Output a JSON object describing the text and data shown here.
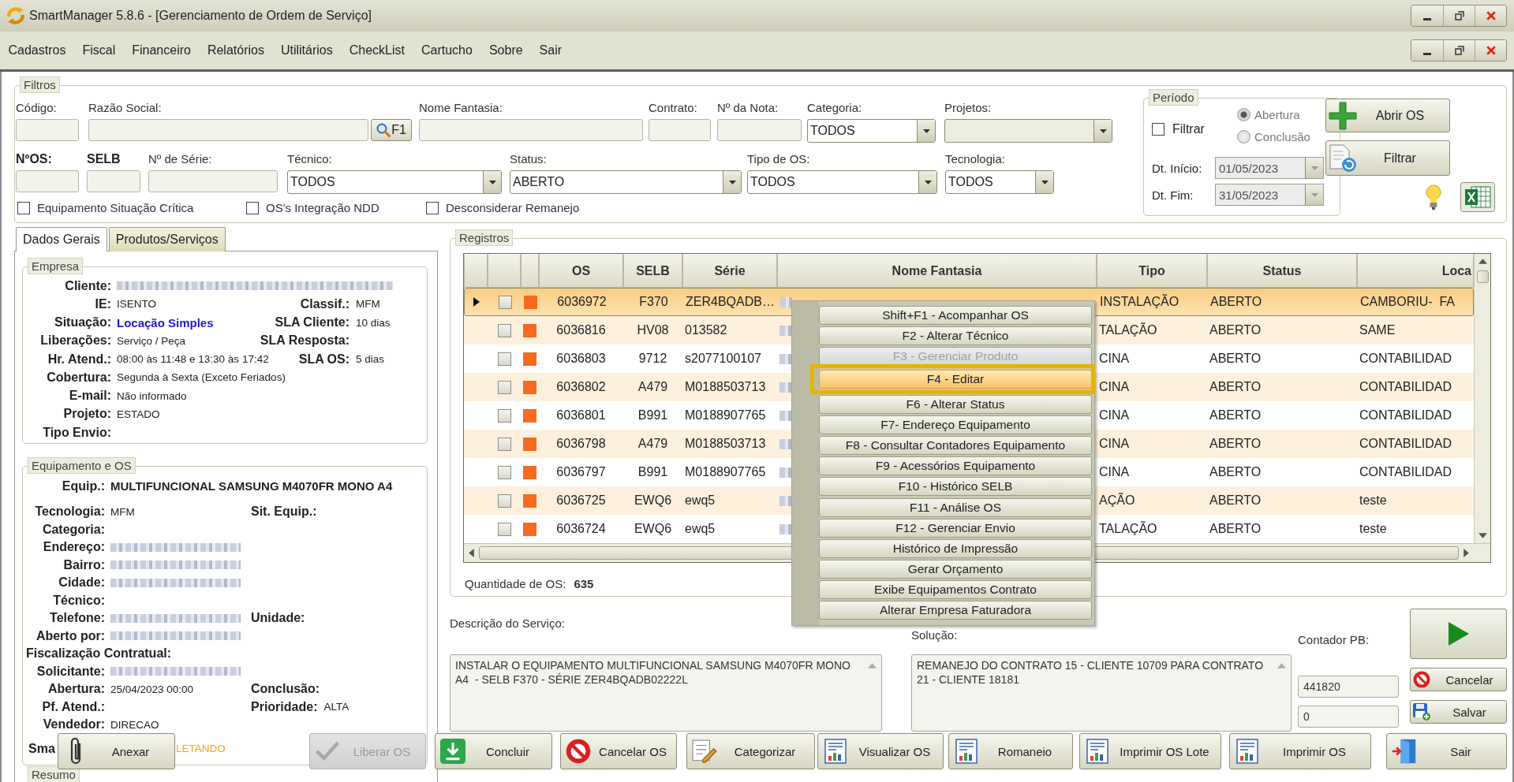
{
  "window": {
    "title": "SmartManager 5.8.6 - [Gerenciamento de Ordem de Serviço]"
  },
  "menu": [
    "Cadastros",
    "Fiscal",
    "Financeiro",
    "Relatórios",
    "Utilitários",
    "CheckList",
    "Cartucho",
    "Sobre",
    "Sair"
  ],
  "filters": {
    "title": "Filtros",
    "row1": [
      {
        "label": "Código:",
        "kind": "text",
        "bold": false
      },
      {
        "label": "Razão Social:",
        "kind": "search",
        "button": "F1",
        "bold": false
      },
      {
        "label": "Nome Fantasia:",
        "kind": "text",
        "bold": false
      },
      {
        "label": "Contrato:",
        "kind": "text",
        "bold": false
      },
      {
        "label": "Nº da Nota:",
        "kind": "text",
        "bold": false
      },
      {
        "label": "Categoria:",
        "kind": "select",
        "value": "TODOS",
        "bold": false
      },
      {
        "label": "Projetos:",
        "kind": "select",
        "bold": false
      }
    ],
    "row2": [
      {
        "label": "NºOS:",
        "kind": "text",
        "bold": true
      },
      {
        "label": "SELB",
        "kind": "text",
        "bold": true
      },
      {
        "label": "Nº de Série:",
        "kind": "text",
        "bold": false
      },
      {
        "label": "Técnico:",
        "kind": "select",
        "value": "TODOS",
        "bold": false
      },
      {
        "label": "Status:",
        "kind": "select",
        "value": "ABERTO",
        "bold": false
      },
      {
        "label": "Tipo de OS:",
        "kind": "select",
        "value": "TODOS",
        "bold": false
      },
      {
        "label": "Tecnologia:",
        "kind": "select",
        "value": "TODOS",
        "bold": false
      }
    ],
    "checks": [
      {
        "label": "Equipamento Situação Crítica",
        "checked": false
      },
      {
        "label": "OS's Integração NDD",
        "checked": false
      },
      {
        "label": "Desconsiderar Remanejo",
        "checked": false
      }
    ]
  },
  "periodo": {
    "title": "Período",
    "filter": {
      "label": "Filtrar",
      "checked": false
    },
    "options": [
      {
        "label": "Abertura",
        "selected": true,
        "disabled": true
      },
      {
        "label": "Conclusão",
        "selected": false,
        "disabled": true
      }
    ],
    "dates": [
      {
        "label": "Dt. Início:",
        "value": "01/05/2023",
        "disabled": true
      },
      {
        "label": "Dt. Fim:",
        "value": "31/05/2023",
        "disabled": true
      }
    ]
  },
  "actions": [
    {
      "label": "Abrir OS",
      "kind": "add"
    },
    {
      "label": "Filtrar",
      "kind": "filter"
    }
  ],
  "tools": [
    {
      "kind": "tip"
    },
    {
      "kind": "excel"
    }
  ],
  "tabs": [
    {
      "label": "Dados Gerais",
      "selected": true
    },
    {
      "label": "Produtos/Serviços",
      "selected": false
    }
  ],
  "empresa": {
    "title": "Empresa",
    "rows": [
      [
        {
          "label": "Cliente:",
          "redacted": true
        }
      ],
      [
        {
          "label": "IE:",
          "value": "ISENTO"
        },
        {
          "label": "Classif.:",
          "value": "MFM"
        }
      ],
      [
        {
          "label": "Situação:",
          "value": "Locação Simples",
          "color": "#1c1cd0",
          "bold": true
        },
        {
          "label": "SLA Cliente:",
          "value": "10 dias"
        }
      ],
      [
        {
          "label": "Liberações:",
          "value": "Serviço / Peça"
        },
        {
          "label": "SLA Resposta:"
        }
      ],
      [
        {
          "label": "Hr. Atend.:",
          "value": "08:00 às 11:48 e 13:30 às 17:42"
        },
        {
          "label": "SLA OS:",
          "value": "5 dias"
        }
      ],
      [
        {
          "label": "Cobertura:",
          "value": "Segunda à Sexta (Exceto Feriados)"
        }
      ],
      [
        {
          "label": "E-mail:",
          "value": "Não informado"
        }
      ],
      [
        {
          "label": "Projeto:",
          "value": "ESTADO"
        }
      ],
      [
        {
          "label": "Tipo Envio:"
        }
      ]
    ]
  },
  "equipamento": {
    "title": "Equipamento e OS",
    "rows": [
      [
        {
          "label": "Equip.:",
          "value": "MULTIFUNCIONAL SAMSUNG M4070FR MONO A4",
          "bold": true
        }
      ],
      [
        {
          "label": "Tecnologia:",
          "value": "MFM"
        },
        {
          "label": "Sit. Equip.:"
        }
      ],
      [
        {
          "label": "Categoria:"
        }
      ],
      [
        {
          "label": "Endereço:",
          "redacted": true
        }
      ],
      [
        {
          "label": "Bairro:",
          "redacted": true
        }
      ],
      [
        {
          "label": "Cidade:",
          "redacted": true
        }
      ],
      [
        {
          "label": "Técnico:"
        }
      ],
      [
        {
          "label": "Telefone:",
          "redacted": true
        },
        {
          "label": "Unidade:"
        }
      ],
      [
        {
          "label": "Aberto por:",
          "redacted": true
        }
      ],
      [
        {
          "label": "Fiscalização Contratual:"
        }
      ],
      [
        {
          "label": "Solicitante:",
          "redacted": true
        }
      ],
      [
        {
          "label": "Abertura:",
          "value": "25/04/2023 00:00"
        },
        {
          "label": "Conclusão:"
        }
      ],
      [
        {
          "label": "Pf. Atend.:"
        },
        {
          "label": "Prioridade:",
          "value": "ALTA"
        }
      ],
      [
        {
          "label": "Vendedor:",
          "value": "DIRECAO"
        }
      ]
    ],
    "partial_row": {
      "label": "Sma",
      "value": "LETANDO",
      "color": "#f7a21b"
    }
  },
  "resumo": {
    "title": "Resumo"
  },
  "registros": {
    "title": "Registros",
    "columns": [
      "OS",
      "SELB",
      "Série",
      "Nome Fantasia",
      "Tipo",
      "Status",
      "Loca"
    ],
    "rows": [
      {
        "selected": true,
        "checked": false,
        "color": "#f86a1e",
        "os": "6036972",
        "selb": "F370",
        "serie": "ZER4BQADB…",
        "nome_fantasia": {
          "redacted": true
        },
        "tipo": "INSTALAÇÃO",
        "status": "ABERTO",
        "column_7": "CAMBORIU-  FA"
      },
      {
        "selected": false,
        "checked": false,
        "color": "#f86a1e",
        "os": "6036816",
        "selb": "HV08",
        "serie": "013582",
        "nome_fantasia": {
          "redacted": true
        },
        "tipo": "TALAÇÃO",
        "status": "ABERTO",
        "column_7": "SAME"
      },
      {
        "selected": false,
        "checked": false,
        "color": "#f86a1e",
        "os": "6036803",
        "selb": "9712",
        "serie": "s2077100107",
        "nome_fantasia": {
          "redacted": true
        },
        "tipo": "CINA",
        "status": "ABERTO",
        "column_7": "CONTABILIDAD"
      },
      {
        "selected": false,
        "checked": false,
        "color": "#f86a1e",
        "os": "6036802",
        "selb": "A479",
        "serie": "M0188503713",
        "nome_fantasia": {
          "redacted": true
        },
        "tipo": "CINA",
        "status": "ABERTO",
        "column_7": "CONTABILIDAD"
      },
      {
        "selected": false,
        "checked": false,
        "color": "#f86a1e",
        "os": "6036801",
        "selb": "B991",
        "serie": "M0188907765",
        "nome_fantasia": {
          "redacted": true
        },
        "tipo": "CINA",
        "status": "ABERTO",
        "column_7": "CONTABILIDAD"
      },
      {
        "selected": false,
        "checked": false,
        "color": "#f86a1e",
        "os": "6036798",
        "selb": "A479",
        "serie": "M0188503713",
        "nome_fantasia": {
          "redacted": true
        },
        "tipo": "CINA",
        "status": "ABERTO",
        "column_7": "CONTABILIDAD"
      },
      {
        "selected": false,
        "checked": false,
        "color": "#f86a1e",
        "os": "6036797",
        "selb": "B991",
        "serie": "M0188907765",
        "nome_fantasia": {
          "redacted": true
        },
        "tipo": "CINA",
        "status": "ABERTO",
        "column_7": "CONTABILIDAD"
      },
      {
        "selected": false,
        "checked": false,
        "color": "#f86a1e",
        "os": "6036725",
        "selb": "EWQ6",
        "serie": "ewq5",
        "nome_fantasia": {
          "redacted": true
        },
        "tipo": "AÇÃO",
        "status": "ABERTO",
        "column_7": "teste"
      },
      {
        "selected": false,
        "checked": false,
        "color": "#f86a1e",
        "os": "6036724",
        "selb": "EWQ6",
        "serie": "ewq5",
        "nome_fantasia": {
          "redacted": true
        },
        "tipo": "TALAÇÃO",
        "status": "ABERTO",
        "column_7": "teste"
      }
    ],
    "count_label": "Quantidade de OS:",
    "count": "635"
  },
  "context_menu": {
    "items": [
      {
        "label": "Shift+F1 - Acompanhar OS",
        "disabled": false,
        "selected": false,
        "highlighted": false
      },
      {
        "label": "F2 - Alterar Técnico",
        "disabled": false,
        "selected": false,
        "highlighted": false
      },
      {
        "label": "F3 - Gerenciar Produto",
        "disabled": true,
        "selected": false,
        "highlighted": false
      },
      {
        "label": "F4 - Editar",
        "disabled": false,
        "selected": true,
        "highlighted": true
      },
      {
        "label": "F6 - Alterar Status",
        "disabled": false,
        "selected": false,
        "highlighted": false
      },
      {
        "label": "F7- Endereço Equipamento",
        "disabled": false,
        "selected": false,
        "highlighted": false
      },
      {
        "label": "F8 - Consultar Contadores Equipamento",
        "disabled": false,
        "selected": false,
        "highlighted": false
      },
      {
        "label": "F9 - Acessórios Equipamento",
        "disabled": false,
        "selected": false,
        "highlighted": false
      },
      {
        "label": "F10 - Histórico SELB",
        "disabled": false,
        "selected": false,
        "highlighted": false
      },
      {
        "label": "F11 - Análise OS",
        "disabled": false,
        "selected": false,
        "highlighted": false
      },
      {
        "label": "F12 - Gerenciar Envio",
        "disabled": false,
        "selected": false,
        "highlighted": false
      },
      {
        "label": "Histórico de Impressão",
        "disabled": false,
        "selected": false,
        "highlighted": false
      },
      {
        "label": "Gerar Orçamento",
        "disabled": false,
        "selected": false,
        "highlighted": false
      },
      {
        "label": "Exibe Equipamentos Contrato",
        "disabled": false,
        "selected": false,
        "highlighted": false
      },
      {
        "label": "Alterar Empresa Faturadora",
        "disabled": false,
        "selected": false,
        "highlighted": false
      }
    ]
  },
  "descricao": {
    "label": "Descrição do Serviço:",
    "value": "INSTALAR O EQUIPAMENTO MULTIFUNCIONAL SAMSUNG M4070FR MONO A4  - SELB F370 - SÉRIE ZER4BQADB02222L"
  },
  "solucao": {
    "label": "Solução:",
    "value": "REMANEJO DO CONTRATO 15 - CLIENTE 10709 PARA CONTRATO 21 - CLIENTE 18181"
  },
  "contador": {
    "label": "Contador PB:",
    "fields": [
      "441820",
      "0"
    ]
  },
  "side_buttons": [
    {
      "kind": "play"
    },
    {
      "label": "Cancelar",
      "kind": "cancel"
    },
    {
      "label": "Salvar",
      "kind": "save"
    }
  ],
  "bottom_buttons": [
    {
      "label": "Anexar",
      "kind": "attach",
      "disabled": false
    },
    {
      "label": "Liberar OS",
      "kind": "release",
      "disabled": true
    },
    {
      "label": "Concluir",
      "kind": "conclude",
      "disabled": false
    },
    {
      "label": "Cancelar OS",
      "kind": "cancel",
      "disabled": false
    },
    {
      "label": "Categorizar",
      "kind": "categorize",
      "disabled": false
    },
    {
      "label": "Visualizar OS",
      "kind": "report",
      "disabled": false
    },
    {
      "label": "Romaneio",
      "kind": "report",
      "disabled": false
    },
    {
      "label": "Imprimir OS Lote",
      "kind": "report",
      "disabled": false
    },
    {
      "label": "Imprimir OS",
      "kind": "report",
      "disabled": false
    },
    {
      "label": "Sair",
      "kind": "exit",
      "disabled": false
    }
  ]
}
